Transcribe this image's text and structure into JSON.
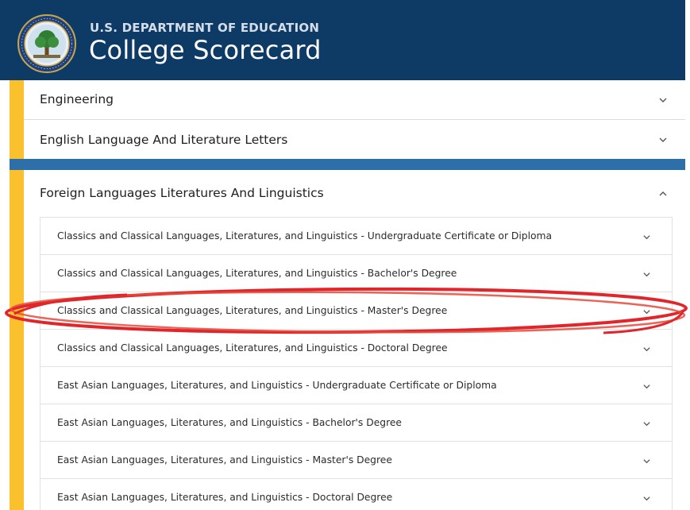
{
  "header": {
    "agency": "U.S. DEPARTMENT OF EDUCATION",
    "title": "College Scorecard"
  },
  "colors": {
    "header_bg": "#0e3b66",
    "accent_yellow": "#fbc02d",
    "band_blue": "#2d6fa8",
    "annotation_red": "#e0262b"
  },
  "accordion": {
    "items": [
      {
        "label": "Engineering",
        "icon": "chevron-down-icon"
      },
      {
        "label": "English Language And Literature Letters",
        "icon": "chevron-down-icon"
      },
      {
        "label": "Foreign Languages Literatures And Linguistics",
        "icon": "chevron-up-icon"
      }
    ],
    "sub_items": [
      {
        "label": "Classics and Classical Languages, Literatures, and Linguistics - Undergraduate Certificate or Diploma"
      },
      {
        "label": "Classics and Classical Languages, Literatures, and Linguistics - Bachelor's Degree"
      },
      {
        "label": "Classics and Classical Languages, Literatures, and Linguistics - Master's Degree"
      },
      {
        "label": "Classics and Classical Languages, Literatures, and Linguistics - Doctoral Degree"
      },
      {
        "label": "East Asian Languages, Literatures, and Linguistics - Undergraduate Certificate or Diploma"
      },
      {
        "label": "East Asian Languages, Literatures, and Linguistics - Bachelor's Degree"
      },
      {
        "label": "East Asian Languages, Literatures, and Linguistics - Master's Degree"
      },
      {
        "label": "East Asian Languages, Literatures, and Linguistics - Doctoral Degree"
      }
    ]
  }
}
